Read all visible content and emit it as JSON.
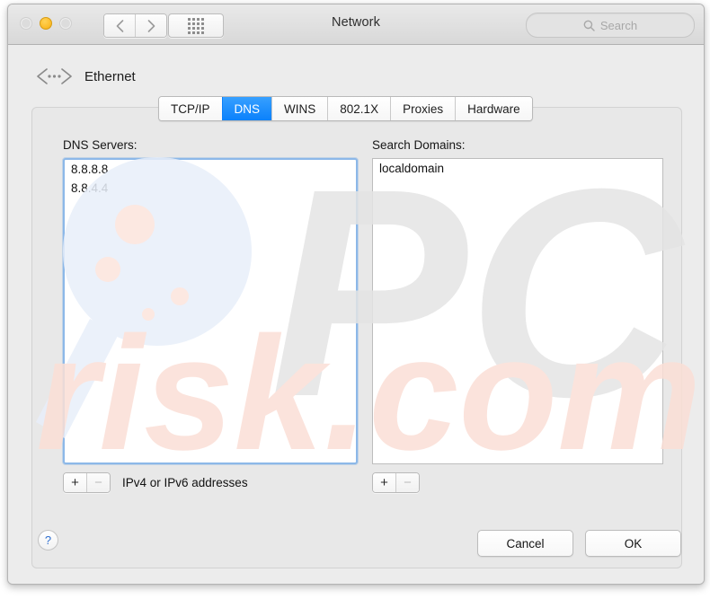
{
  "window": {
    "title": "Network",
    "traffic_lights": [
      {
        "name": "close",
        "state": "inactive"
      },
      {
        "name": "minimize",
        "state": "amber",
        "color": "#fcbd2b"
      },
      {
        "name": "zoom",
        "state": "inactive"
      }
    ],
    "nav": {
      "back_icon": "chevron-left-icon",
      "forward_icon": "chevron-right-icon"
    },
    "show_all_icon": "grid-dots-icon",
    "search": {
      "placeholder": "Search",
      "value": "",
      "icon": "search-icon"
    }
  },
  "interface": {
    "icon": "ethernet-icon",
    "name": "Ethernet"
  },
  "tabs": [
    {
      "label": "TCP/IP",
      "active": false
    },
    {
      "label": "DNS",
      "active": true
    },
    {
      "label": "WINS",
      "active": false
    },
    {
      "label": "802.1X",
      "active": false
    },
    {
      "label": "Proxies",
      "active": false
    },
    {
      "label": "Hardware",
      "active": false
    }
  ],
  "accent_color": "#0b81fb",
  "dns_servers": {
    "label": "DNS Servers:",
    "entries": [
      "8.8.8.8",
      "8.8.4.4"
    ],
    "focused": true,
    "add_label": "+",
    "remove_label": "−",
    "remove_enabled": false,
    "hint": "IPv4 or IPv6 addresses"
  },
  "search_domains": {
    "label": "Search Domains:",
    "entries": [
      "localdomain"
    ],
    "focused": false,
    "add_label": "+",
    "remove_label": "−",
    "remove_enabled": false
  },
  "footer": {
    "help_label": "?",
    "cancel_label": "Cancel",
    "ok_label": "OK"
  },
  "watermark": {
    "primary_text": "PC",
    "secondary_text": "risk.com",
    "grey": "#e2e2e2",
    "pink": "#fbe0d8",
    "blue": "#e6eefb"
  }
}
